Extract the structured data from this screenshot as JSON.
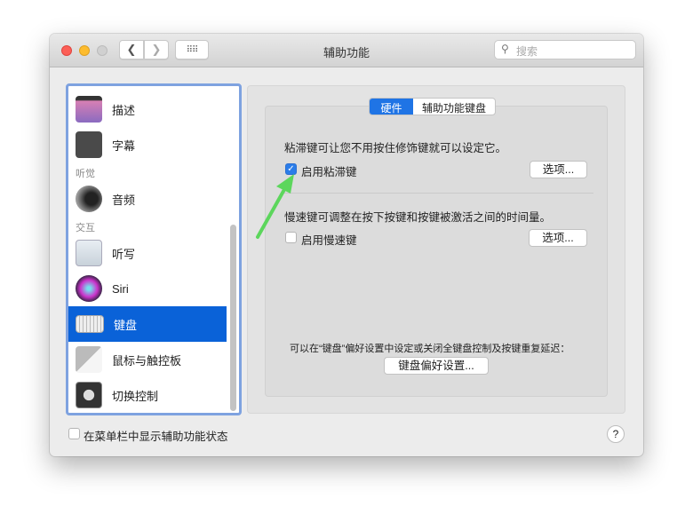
{
  "window": {
    "title": "辅助功能",
    "search_placeholder": "搜索",
    "grid_icon": "grid-icon"
  },
  "sidebar": {
    "items": [
      {
        "label": "描述",
        "icon": "description-icon"
      },
      {
        "label": "字幕",
        "icon": "captions-icon"
      },
      {
        "label": "音频",
        "icon": "speaker-icon"
      },
      {
        "label": "听写",
        "icon": "microphone-icon"
      },
      {
        "label": "Siri",
        "icon": "siri-icon"
      },
      {
        "label": "键盘",
        "icon": "keyboard-icon",
        "selected": true
      },
      {
        "label": "鼠标与触控板",
        "icon": "mouse-icon"
      },
      {
        "label": "切换控制",
        "icon": "switch-control-icon"
      }
    ],
    "sections": {
      "hearing": "听觉",
      "interaction": "交互"
    }
  },
  "tabs": [
    "硬件",
    "辅助功能键盘"
  ],
  "sticky": {
    "description": "粘滞键可让您不用按住修饰键就可以设定它。",
    "checkbox_label": "启用粘滞键",
    "checked": true,
    "options": "选项..."
  },
  "slow": {
    "description": "慢速键可调整在按下按键和按键被激活之间的时间量。",
    "checkbox_label": "启用慢速键",
    "checked": false,
    "options": "选项..."
  },
  "footer_note": "可以在“键盘”偏好设置中设定或关闭全键盘控制及按键重复延迟：",
  "keyboard_prefs_button": "键盘偏好设置...",
  "menu_bar_checkbox": {
    "label": "在菜单栏中显示辅助功能状态",
    "checked": false
  },
  "help": "?",
  "colors": {
    "accent": "#0a62d8",
    "arrow": "#5cd65c"
  }
}
